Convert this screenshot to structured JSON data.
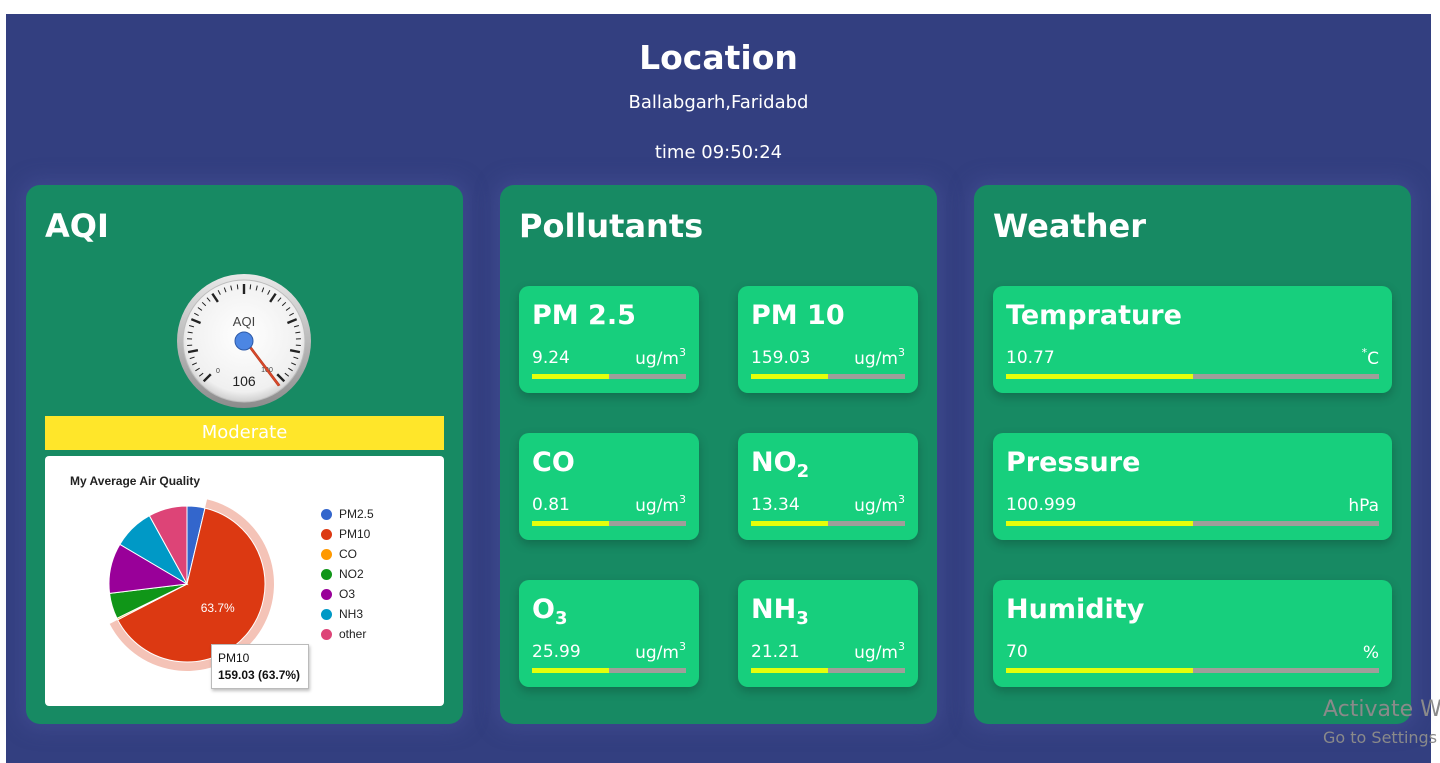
{
  "header": {
    "title": "Location",
    "location": "Ballabgarh,Faridabd",
    "time": "time 09:50:24"
  },
  "aqi": {
    "title": "AQI",
    "gauge_label": "AQI",
    "gauge_value": "106",
    "gauge_min": "0",
    "gauge_max": "100",
    "status": "Moderate",
    "status_color": "#ffe62a",
    "pie": {
      "title": "My Average Air Quality",
      "slice_label": "63.7%",
      "tooltip_name": "PM10",
      "tooltip_value": "159.03 (63.7%)",
      "legend": [
        {
          "label": "PM2.5",
          "color": "#3366cc"
        },
        {
          "label": "PM10",
          "color": "#dc3912"
        },
        {
          "label": "CO",
          "color": "#ff9900"
        },
        {
          "label": "NO2",
          "color": "#109618"
        },
        {
          "label": "O3",
          "color": "#990099"
        },
        {
          "label": "NH3",
          "color": "#0099c6"
        },
        {
          "label": "other",
          "color": "#dd4477"
        }
      ],
      "slices": [
        {
          "label": "PM2.5",
          "value": 9.24
        },
        {
          "label": "PM10",
          "value": 159.03
        },
        {
          "label": "CO",
          "value": 0.81
        },
        {
          "label": "NO2",
          "value": 13.34
        },
        {
          "label": "O3",
          "value": 25.99
        },
        {
          "label": "NH3",
          "value": 21.21
        },
        {
          "label": "other",
          "value": 20.0
        }
      ]
    }
  },
  "pollutants": {
    "title": "Pollutants",
    "items": [
      {
        "name": "PM 2.5",
        "sub": "",
        "value": "9.24",
        "unit": "ug/m",
        "unit_sup": "3",
        "level": 0.5
      },
      {
        "name": "PM 10",
        "sub": "",
        "value": "159.03",
        "unit": "ug/m",
        "unit_sup": "3",
        "level": 0.5
      },
      {
        "name": "CO",
        "sub": "",
        "value": "0.81",
        "unit": "ug/m",
        "unit_sup": "3",
        "level": 0.5
      },
      {
        "name": "NO",
        "sub": "2",
        "value": "13.34",
        "unit": "ug/m",
        "unit_sup": "3",
        "level": 0.5
      },
      {
        "name": "O",
        "sub": "3",
        "value": "25.99",
        "unit": "ug/m",
        "unit_sup": "3",
        "level": 0.5
      },
      {
        "name": "NH",
        "sub": "3",
        "value": "21.21",
        "unit": "ug/m",
        "unit_sup": "3",
        "level": 0.5
      }
    ]
  },
  "weather": {
    "title": "Weather",
    "items": [
      {
        "name": "Temprature",
        "value": "10.77",
        "unit_sup": "*",
        "unit": "C",
        "level": 0.5
      },
      {
        "name": "Pressure",
        "value": "100.999",
        "unit_sup": "",
        "unit": "hPa",
        "level": 0.5
      },
      {
        "name": "Humidity",
        "value": "70",
        "unit_sup": "",
        "unit": "%",
        "level": 0.5
      }
    ]
  },
  "watermark": {
    "line1": "Activate W",
    "line2": "Go to Settings"
  },
  "colors": {
    "background": "#333f80",
    "panel": "#178a63",
    "card": "#17cf7d",
    "bar_fill": "#e4ff0a",
    "bar_track": "#a09e9a"
  }
}
